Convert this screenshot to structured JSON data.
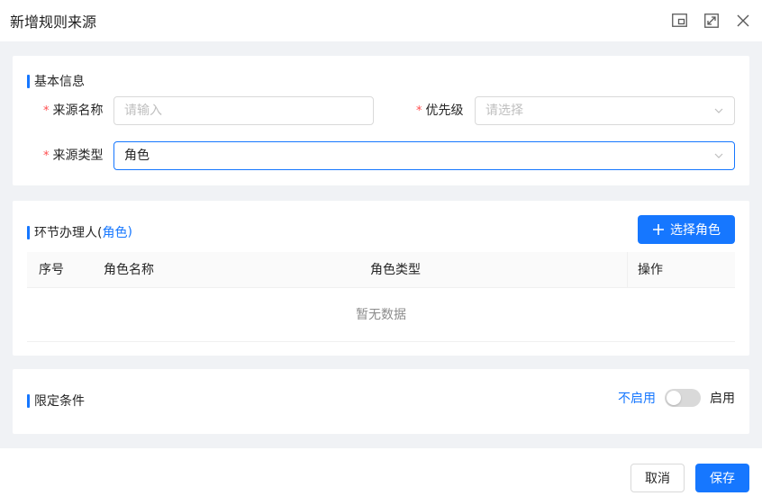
{
  "dialog": {
    "title": "新增规则来源",
    "icons": [
      "restore-icon",
      "expand-icon",
      "close-icon"
    ]
  },
  "basic": {
    "section_title": "基本信息",
    "source_name_label": "来源名称",
    "source_name_placeholder": "请输入",
    "priority_label": "优先级",
    "priority_placeholder": "请选择",
    "source_type_label": "来源类型",
    "source_type_value": "角色",
    "required_mark": "*"
  },
  "handler": {
    "section_title_prefix": "环节办理人(",
    "section_title_highlight": "角色",
    "section_title_suffix": ")",
    "select_role_button": "选择角色",
    "columns": [
      "序号",
      "角色名称",
      "角色类型",
      "操作"
    ],
    "empty_text": "暂无数据"
  },
  "condition": {
    "section_title": "限定条件",
    "off_label": "不启用",
    "on_label": "启用",
    "enabled": false
  },
  "footer": {
    "cancel_label": "取消",
    "save_label": "保存"
  },
  "colors": {
    "primary": "#1677ff",
    "required": "#ff4d4f",
    "background": "#f0f2f5"
  }
}
